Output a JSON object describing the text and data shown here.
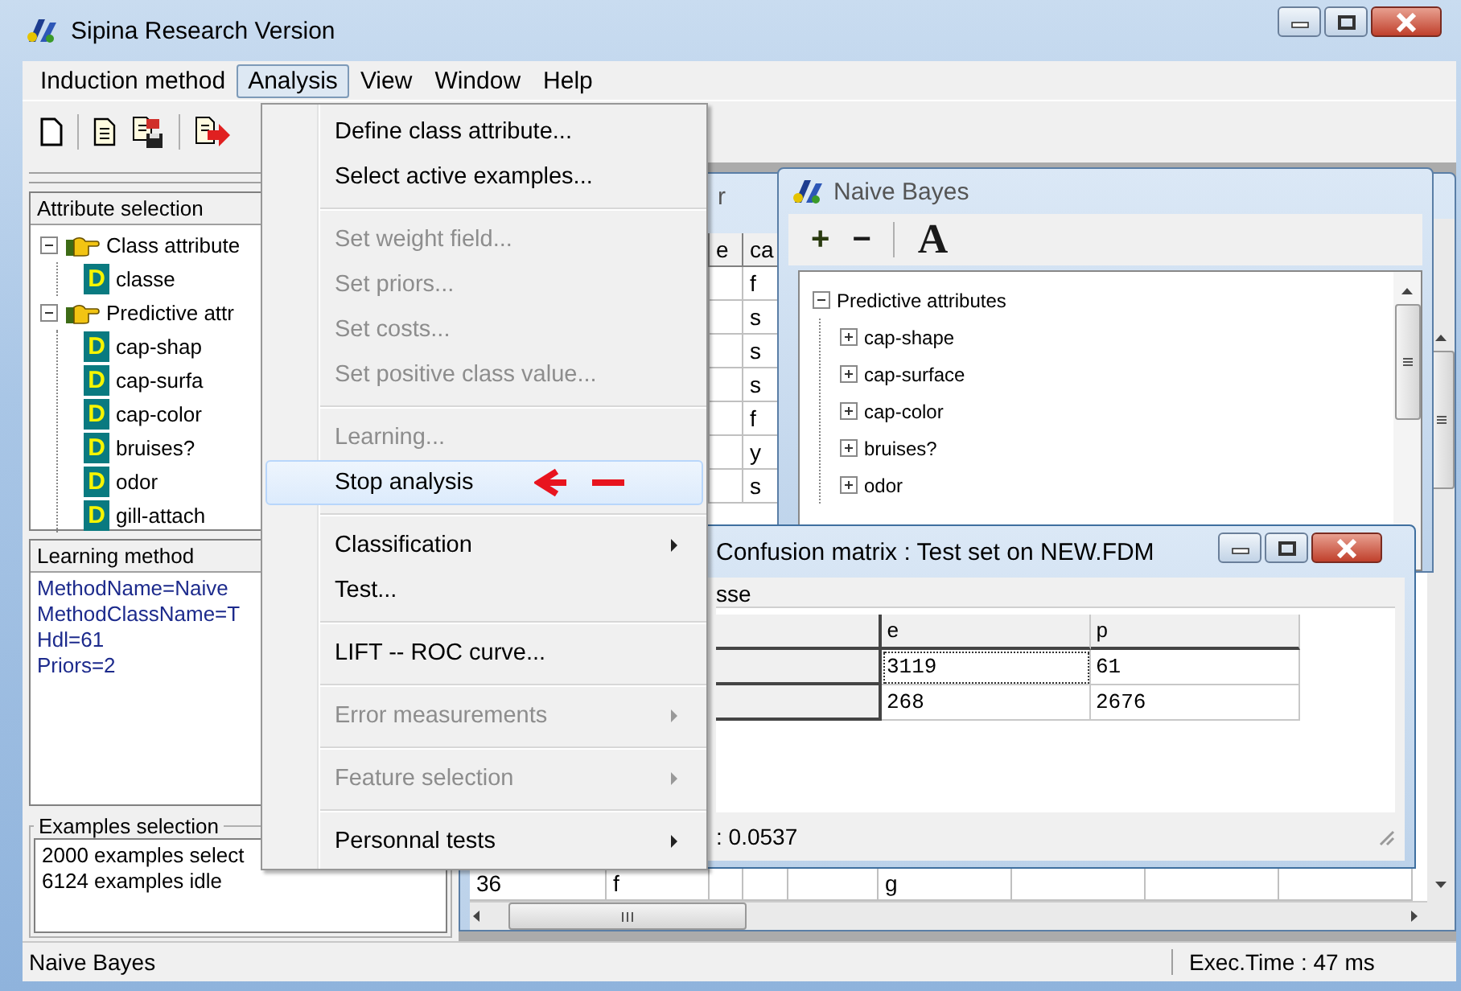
{
  "window": {
    "title": "Sipina Research Version"
  },
  "menu_bar": [
    {
      "label": "Induction method",
      "selected": false
    },
    {
      "label": "Analysis",
      "selected": true
    },
    {
      "label": "View",
      "selected": false
    },
    {
      "label": "Window",
      "selected": false
    },
    {
      "label": "Help",
      "selected": false
    }
  ],
  "analysis_menu": [
    {
      "kind": "item",
      "label": "Define class attribute...",
      "disabled": false,
      "selected": false,
      "submenu": false,
      "annotated": false
    },
    {
      "kind": "item",
      "label": "Select active examples...",
      "disabled": false,
      "selected": false,
      "submenu": false,
      "annotated": false
    },
    {
      "kind": "separator"
    },
    {
      "kind": "item",
      "label": "Set weight field...",
      "disabled": true,
      "selected": false,
      "submenu": false,
      "annotated": false
    },
    {
      "kind": "item",
      "label": "Set priors...",
      "disabled": true,
      "selected": false,
      "submenu": false,
      "annotated": false
    },
    {
      "kind": "item",
      "label": "Set costs...",
      "disabled": true,
      "selected": false,
      "submenu": false,
      "annotated": false
    },
    {
      "kind": "item",
      "label": "Set positive class value...",
      "disabled": true,
      "selected": false,
      "submenu": false,
      "annotated": false
    },
    {
      "kind": "separator"
    },
    {
      "kind": "item",
      "label": "Learning...",
      "disabled": true,
      "selected": false,
      "submenu": false,
      "annotated": false
    },
    {
      "kind": "item",
      "label": "Stop analysis",
      "disabled": false,
      "selected": true,
      "submenu": false,
      "annotated": true
    },
    {
      "kind": "separator"
    },
    {
      "kind": "item",
      "label": "Classification",
      "disabled": false,
      "selected": false,
      "submenu": true,
      "annotated": false
    },
    {
      "kind": "item",
      "label": "Test...",
      "disabled": false,
      "selected": false,
      "submenu": false,
      "annotated": false
    },
    {
      "kind": "separator"
    },
    {
      "kind": "item",
      "label": "LIFT -- ROC curve...",
      "disabled": false,
      "selected": false,
      "submenu": false,
      "annotated": false
    },
    {
      "kind": "separator"
    },
    {
      "kind": "item",
      "label": "Error measurements",
      "disabled": true,
      "selected": false,
      "submenu": true,
      "annotated": false
    },
    {
      "kind": "separator"
    },
    {
      "kind": "item",
      "label": "Feature selection",
      "disabled": true,
      "selected": false,
      "submenu": true,
      "annotated": false
    },
    {
      "kind": "separator"
    },
    {
      "kind": "item",
      "label": "Personnal tests",
      "disabled": false,
      "selected": false,
      "submenu": true,
      "annotated": false
    }
  ],
  "left_panel": {
    "attribute_selection": {
      "title": "Attribute selection",
      "tree": [
        {
          "label": "Class attribute",
          "expanded": true,
          "children": [
            {
              "label": "classe",
              "type": "D"
            }
          ]
        },
        {
          "label": "Predictive attr",
          "expanded": true,
          "children": [
            {
              "label": "cap-shap",
              "type": "D"
            },
            {
              "label": "cap-surfa",
              "type": "D"
            },
            {
              "label": "cap-color",
              "type": "D"
            },
            {
              "label": "bruises?",
              "type": "D"
            },
            {
              "label": "odor",
              "type": "D"
            },
            {
              "label": "gill-attach",
              "type": "D"
            }
          ]
        }
      ]
    },
    "learning_method": {
      "title": "Learning method",
      "lines": [
        "MethodName=Naive",
        "MethodClassName=T",
        "Hdl=61",
        "Priors=2"
      ]
    },
    "examples_selection": {
      "title": "Examples selection",
      "lines": [
        "2000 examples select",
        "6124 examples idle"
      ]
    }
  },
  "data_window": {
    "title": "r",
    "headers": [
      "e",
      "ca"
    ],
    "column_4": [
      "f",
      "s",
      "s",
      "s",
      "f",
      "y",
      "s"
    ],
    "last_row": [
      "36",
      "f",
      "g"
    ]
  },
  "naive_bayes_window": {
    "title": "Naive Bayes",
    "toolbar": [
      "+",
      "−",
      "A"
    ],
    "tree": {
      "label": "Predictive attributes",
      "expanded": true,
      "children": [
        {
          "label": "cap-shape",
          "expanded": false
        },
        {
          "label": "cap-surface",
          "expanded": false
        },
        {
          "label": "cap-color",
          "expanded": false
        },
        {
          "label": "bruises?",
          "expanded": false
        },
        {
          "label": "odor",
          "expanded": false
        }
      ]
    }
  },
  "confusion_window": {
    "title": "Confusion matrix : Test set on NEW.FDM",
    "group_label": "sse",
    "columns": [
      "e",
      "p"
    ],
    "rows": [
      {
        "cells": [
          {
            "text": "3119",
            "selected": true
          },
          {
            "text": "61",
            "selected": false
          }
        ]
      },
      {
        "cells": [
          {
            "text": "268",
            "selected": false
          },
          {
            "text": "2676",
            "selected": false
          }
        ]
      }
    ],
    "footer": ": 0.0537"
  },
  "status_bar": {
    "left": "Naive Bayes",
    "right": "Exec.Time : 47 ms"
  }
}
